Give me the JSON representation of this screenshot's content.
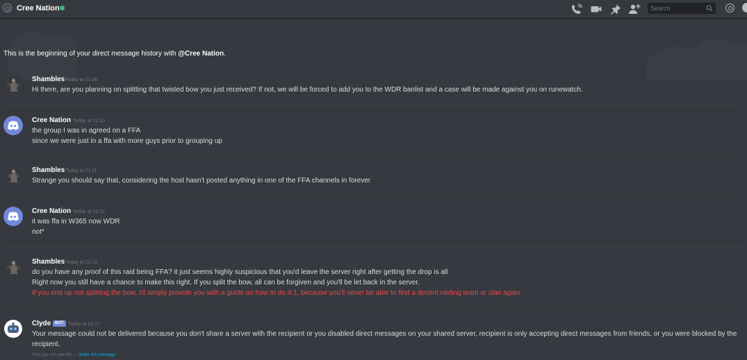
{
  "header": {
    "title": "Cree Nation",
    "status": "online",
    "search_placeholder": "Search"
  },
  "intro": {
    "prefix": "This is the beginning of your direct message history with ",
    "mention": "@Cree Nation",
    "suffix": "."
  },
  "messages": [
    {
      "author": "Shambles",
      "timestamp": "Today at 21:08",
      "lines": [
        "Hi there, are you planning on splitting that twisted bow you just received? If not, we will be forced to add you to the WDR banlist and a case will be made against you on runewatch."
      ]
    },
    {
      "author": "Cree Nation",
      "timestamp": "Today at 21:10",
      "lines": [
        "the group I was in agreed on a FFA",
        "since we were just in a ffa with more guys prior to grouping up"
      ]
    },
    {
      "author": "Shambles",
      "timestamp": "Today at 21:11",
      "lines": [
        "Strange you should say that, considering the host hasn't posted anything in one of the FFA channels in forever"
      ]
    },
    {
      "author": "Cree Nation",
      "timestamp": "Today at 21:12",
      "lines": [
        "it was ffa in W365 now WDR",
        "not*"
      ]
    },
    {
      "author": "Shambles",
      "timestamp": "Today at 21:12",
      "lines": [
        "do you have any proof of this raid being FFA? it just seems highly suspicious that you'd leave the server right after getting the drop is all",
        "Right now you still have a chance to make this right. If you split the bow, all can be forgiven and you'll be let back in the server.",
        "If you end up not splitting the bow, I'll simply provide you with a guide on how to do 4:1, because you'll never be able to find a decent raiding team or clan again."
      ]
    },
    {
      "author": "Clyde",
      "badge": "BOT",
      "timestamp": "Today at 21:17",
      "lines": [
        "Your message could not be delivered because you don't share a server with the recipient or you disabled direct messages on your shared server, recipient is only accepting direct messages from friends, or you were blocked by the recipient."
      ],
      "ephemeral_note": "Only you can see this — ",
      "ephemeral_action": "delete this message"
    }
  ],
  "colors": {
    "background": "#36393f",
    "status_online": "#43b581",
    "warning_text": "#f04747",
    "blurple": "#7289da",
    "link": "#00b0f4"
  }
}
